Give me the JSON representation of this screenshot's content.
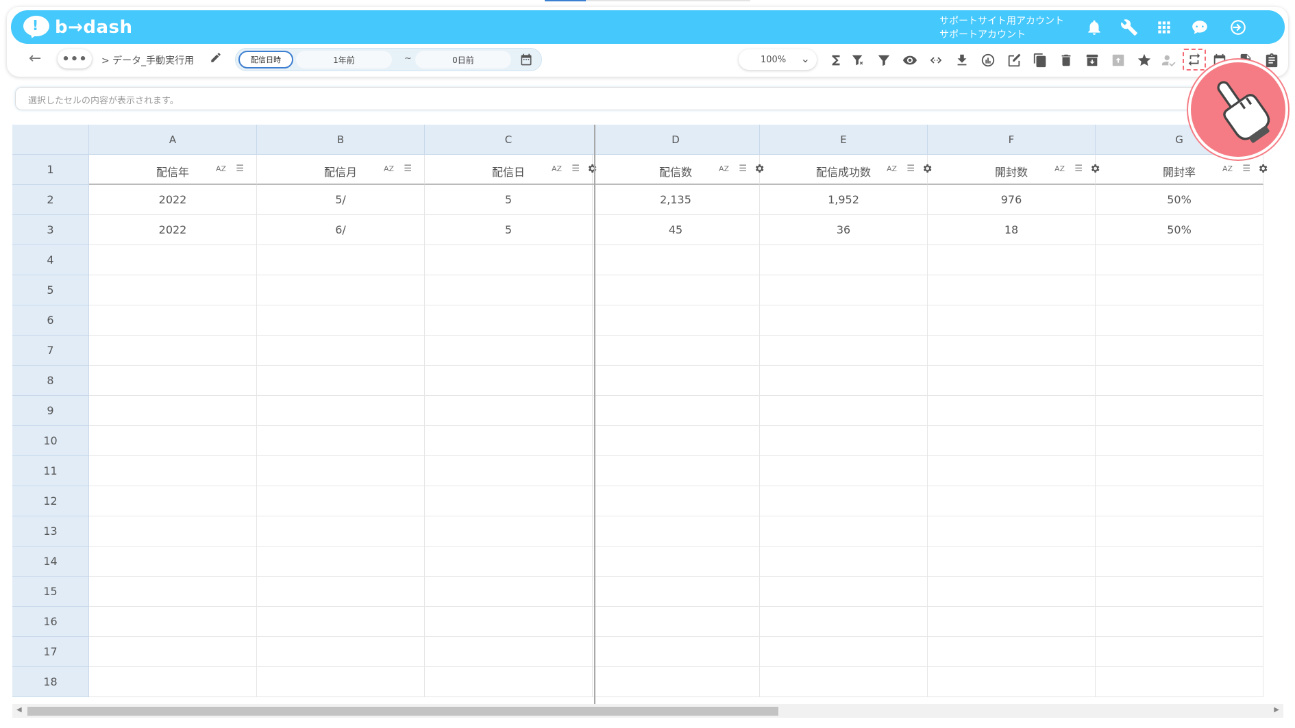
{
  "header": {
    "logo_text": "b→dash",
    "account_line1": "サポートサイト用アカウント",
    "account_line2": "サポートアカウント",
    "icons": [
      "bell-icon",
      "wrench-icon",
      "apps-grid-icon",
      "chat-bot-icon",
      "logout-icon"
    ]
  },
  "toolbar": {
    "back_icon": "arrow-left-icon",
    "more_label": "•••",
    "breadcrumb": "> データ_手動実行用",
    "date_range": {
      "label": "配信日時",
      "from": "1年前",
      "separator": "~",
      "to": "0日前"
    },
    "zoom": "100%",
    "action_icons": [
      "sum-icon",
      "filter-clear-icon",
      "filter-icon",
      "eye-icon",
      "code-icon",
      "download-icon",
      "chart-icon",
      "edit-icon",
      "copy-icon",
      "trash-icon",
      "archive-icon",
      "upload-icon",
      "star-icon",
      "user-check-icon",
      "sync-icon",
      "calendar-icon",
      "file-icon",
      "clipboard-icon"
    ]
  },
  "cell_bar": {
    "placeholder": "選択したセルの内容が表示されます。"
  },
  "sheet": {
    "columns": [
      "A",
      "B",
      "C",
      "D",
      "E",
      "F",
      "G"
    ],
    "header_row_number": "1",
    "headers": [
      "配信年",
      "配信月",
      "配信日",
      "配信数",
      "配信成功数",
      "開封数",
      "開封率"
    ],
    "sort_label": "AZ",
    "rows": [
      {
        "num": "2",
        "cells": [
          "2022",
          "5/",
          "5",
          "2,135",
          "1,952",
          "976",
          "50%"
        ]
      },
      {
        "num": "3",
        "cells": [
          "2022",
          "6/",
          "5",
          "45",
          "36",
          "18",
          "50%"
        ]
      },
      {
        "num": "4",
        "cells": [
          "",
          "",
          "",
          "",
          "",
          "",
          ""
        ]
      },
      {
        "num": "5",
        "cells": [
          "",
          "",
          "",
          "",
          "",
          "",
          ""
        ]
      },
      {
        "num": "6",
        "cells": [
          "",
          "",
          "",
          "",
          "",
          "",
          ""
        ]
      },
      {
        "num": "7",
        "cells": [
          "",
          "",
          "",
          "",
          "",
          "",
          ""
        ]
      },
      {
        "num": "8",
        "cells": [
          "",
          "",
          "",
          "",
          "",
          "",
          ""
        ]
      },
      {
        "num": "9",
        "cells": [
          "",
          "",
          "",
          "",
          "",
          "",
          ""
        ]
      },
      {
        "num": "10",
        "cells": [
          "",
          "",
          "",
          "",
          "",
          "",
          ""
        ]
      },
      {
        "num": "11",
        "cells": [
          "",
          "",
          "",
          "",
          "",
          "",
          ""
        ]
      },
      {
        "num": "12",
        "cells": [
          "",
          "",
          "",
          "",
          "",
          "",
          ""
        ]
      },
      {
        "num": "13",
        "cells": [
          "",
          "",
          "",
          "",
          "",
          "",
          ""
        ]
      },
      {
        "num": "14",
        "cells": [
          "",
          "",
          "",
          "",
          "",
          "",
          ""
        ]
      },
      {
        "num": "15",
        "cells": [
          "",
          "",
          "",
          "",
          "",
          "",
          ""
        ]
      },
      {
        "num": "16",
        "cells": [
          "",
          "",
          "",
          "",
          "",
          "",
          ""
        ]
      },
      {
        "num": "17",
        "cells": [
          "",
          "",
          "",
          "",
          "",
          "",
          ""
        ]
      },
      {
        "num": "18",
        "cells": [
          "",
          "",
          "",
          "",
          "",
          "",
          ""
        ]
      }
    ]
  },
  "colors": {
    "header_bg": "#45c8fb",
    "grid_header_bg": "#e1ecf7",
    "highlight": "#f46a74",
    "hand_bg": "#f57c84"
  },
  "overlay": {
    "icon": "pointing-hand-icon"
  }
}
